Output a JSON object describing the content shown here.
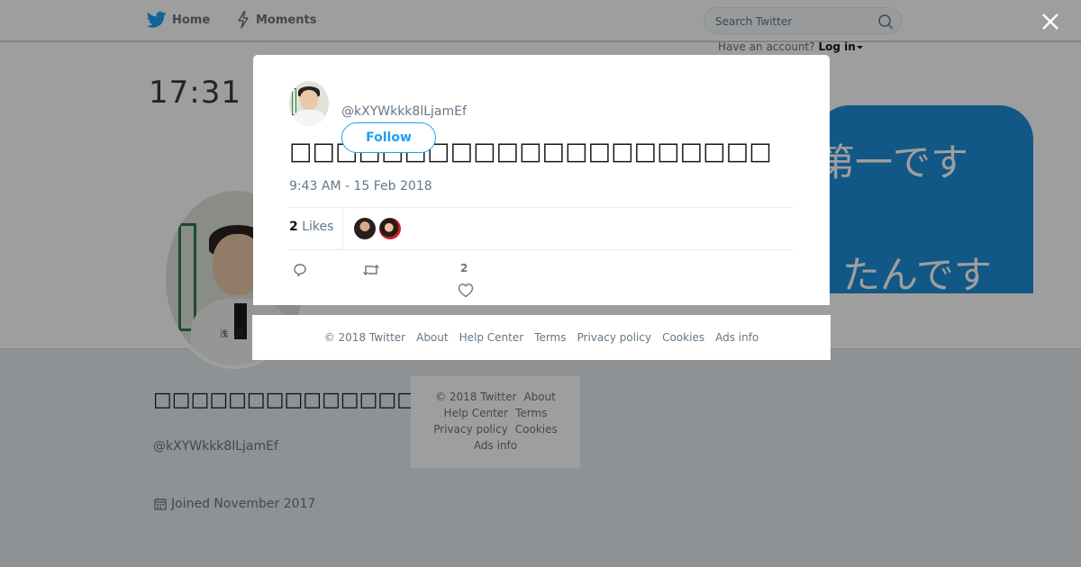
{
  "nav": {
    "home_label": "Home",
    "moments_label": "Moments",
    "search_placeholder": "Search Twitter",
    "have_account_text": "Have an account?",
    "login_label": "Log in"
  },
  "banner": {
    "time_text": "17:31",
    "line1": "第一です",
    "line2": "たんです"
  },
  "profile": {
    "name": "□□□□□□□□□□□□□□□□□□□□□",
    "handle": "@kXYWkkk8lLjamEf",
    "joined": "Joined November 2017",
    "avatar_nametag": "浅 井 亮"
  },
  "background_footer": {
    "items": [
      "© 2018 Twitter",
      "About",
      "Help Center",
      "Terms",
      "Privacy policy",
      "Cookies",
      "Ads info"
    ]
  },
  "tweet": {
    "handle": "@kXYWkkk8lLjamEf",
    "follow_label": "Follow",
    "text": "□□□□□□□□□□□□□□□□□□□□□",
    "time": "9:43 AM - 15 Feb 2018",
    "likes_count": "2",
    "likes_label": "Likes",
    "like_action_count": "2"
  },
  "modal_footer": {
    "items": [
      "© 2018 Twitter",
      "About",
      "Help Center",
      "Terms",
      "Privacy policy",
      "Cookies",
      "Ads info"
    ]
  },
  "colors": {
    "accent": "#1da1f2",
    "muted_text": "#657786",
    "banner_blue": "#1d8fd8"
  },
  "icons": [
    "twitter-bird-icon",
    "lightning-icon",
    "search-icon",
    "caret-down-icon",
    "close-icon",
    "calendar-icon",
    "reply-icon",
    "retweet-icon",
    "heart-icon"
  ]
}
